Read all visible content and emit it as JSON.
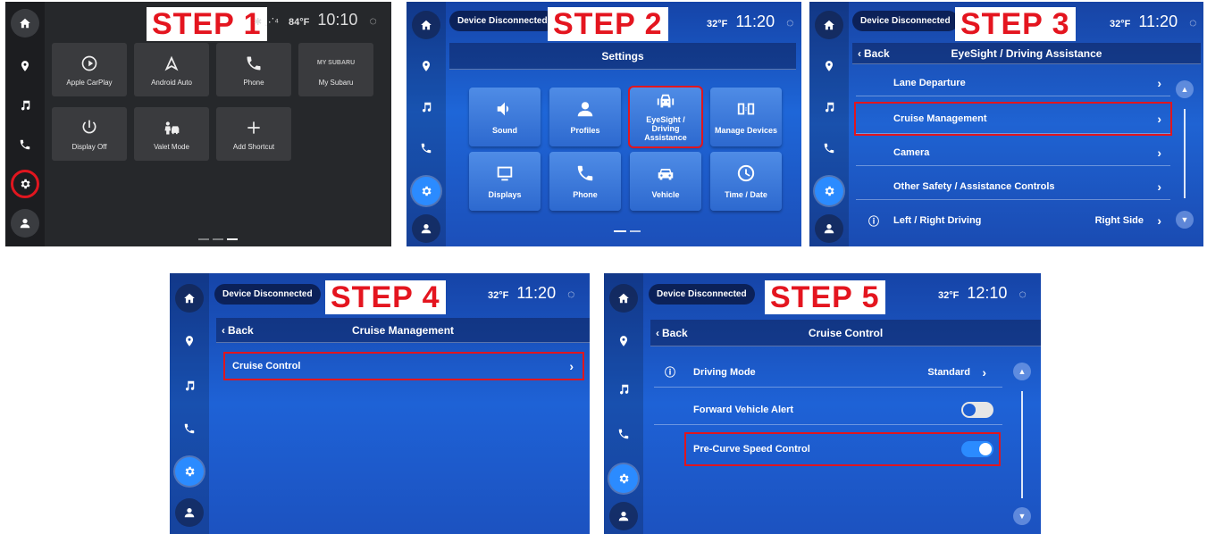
{
  "colors": {
    "highlight": "#e0161f",
    "accent": "#2b8bff",
    "step_text": "#e4151f"
  },
  "step1": {
    "step_label": "STEP 1",
    "status": {
      "icons": "✱ ⋰⁴",
      "temp": "84°F",
      "time": "10:10"
    },
    "tiles": [
      {
        "label": "Apple CarPlay",
        "icon": "carplay-icon"
      },
      {
        "label": "Android Auto",
        "icon": "android-auto-icon"
      },
      {
        "label": "Phone",
        "icon": "phone-icon"
      },
      {
        "label": "My Subaru",
        "icon": "my-subaru-logo",
        "logo_text": "MY SUBARU"
      },
      {
        "label": "Display Off",
        "icon": "power-icon"
      },
      {
        "label": "Valet Mode",
        "icon": "valet-icon"
      },
      {
        "label": "Add Shortcut",
        "icon": "plus-icon"
      }
    ]
  },
  "step2": {
    "step_label": "STEP 2",
    "device": "Device Disconnected",
    "status": {
      "temp": "32°F",
      "time": "11:20"
    },
    "title": "Settings",
    "tiles": [
      {
        "label": "Sound",
        "icon": "speaker-icon"
      },
      {
        "label": "Profiles",
        "icon": "profile-icon"
      },
      {
        "label": "EyeSight / Driving Assistance",
        "icon": "eyesight-icon"
      },
      {
        "label": "Manage Devices",
        "icon": "devices-icon"
      },
      {
        "label": "Displays",
        "icon": "display-icon"
      },
      {
        "label": "Phone",
        "icon": "phone-icon"
      },
      {
        "label": "Vehicle",
        "icon": "car-icon"
      },
      {
        "label": "Time / Date",
        "icon": "clock-icon"
      }
    ]
  },
  "step3": {
    "step_label": "STEP 3",
    "device": "Device Disconnected",
    "status": {
      "temp": "32°F",
      "time": "11:20"
    },
    "back": "Back",
    "title": "EyeSight / Driving Assistance",
    "rows": [
      {
        "label": "Lane Departure"
      },
      {
        "label": "Cruise Management"
      },
      {
        "label": "Camera"
      },
      {
        "label": "Other Safety / Assistance Controls"
      },
      {
        "label": "Left / Right Driving",
        "value": "Right Side"
      }
    ]
  },
  "step4": {
    "step_label": "STEP 4",
    "device": "Device Disconnected",
    "status": {
      "temp": "32°F",
      "time": "11:20"
    },
    "back": "Back",
    "title": "Cruise Management",
    "rows": [
      {
        "label": "Cruise Control"
      }
    ]
  },
  "step5": {
    "step_label": "STEP 5",
    "device": "Device Disconnected",
    "status": {
      "temp": "32°F",
      "time": "12:10"
    },
    "back": "Back",
    "title": "Cruise Control",
    "rows": [
      {
        "label": "Driving Mode",
        "value": "Standard"
      },
      {
        "label": "Forward Vehicle Alert",
        "toggle": "off"
      },
      {
        "label": "Pre-Curve Speed Control",
        "toggle": "on"
      }
    ]
  }
}
